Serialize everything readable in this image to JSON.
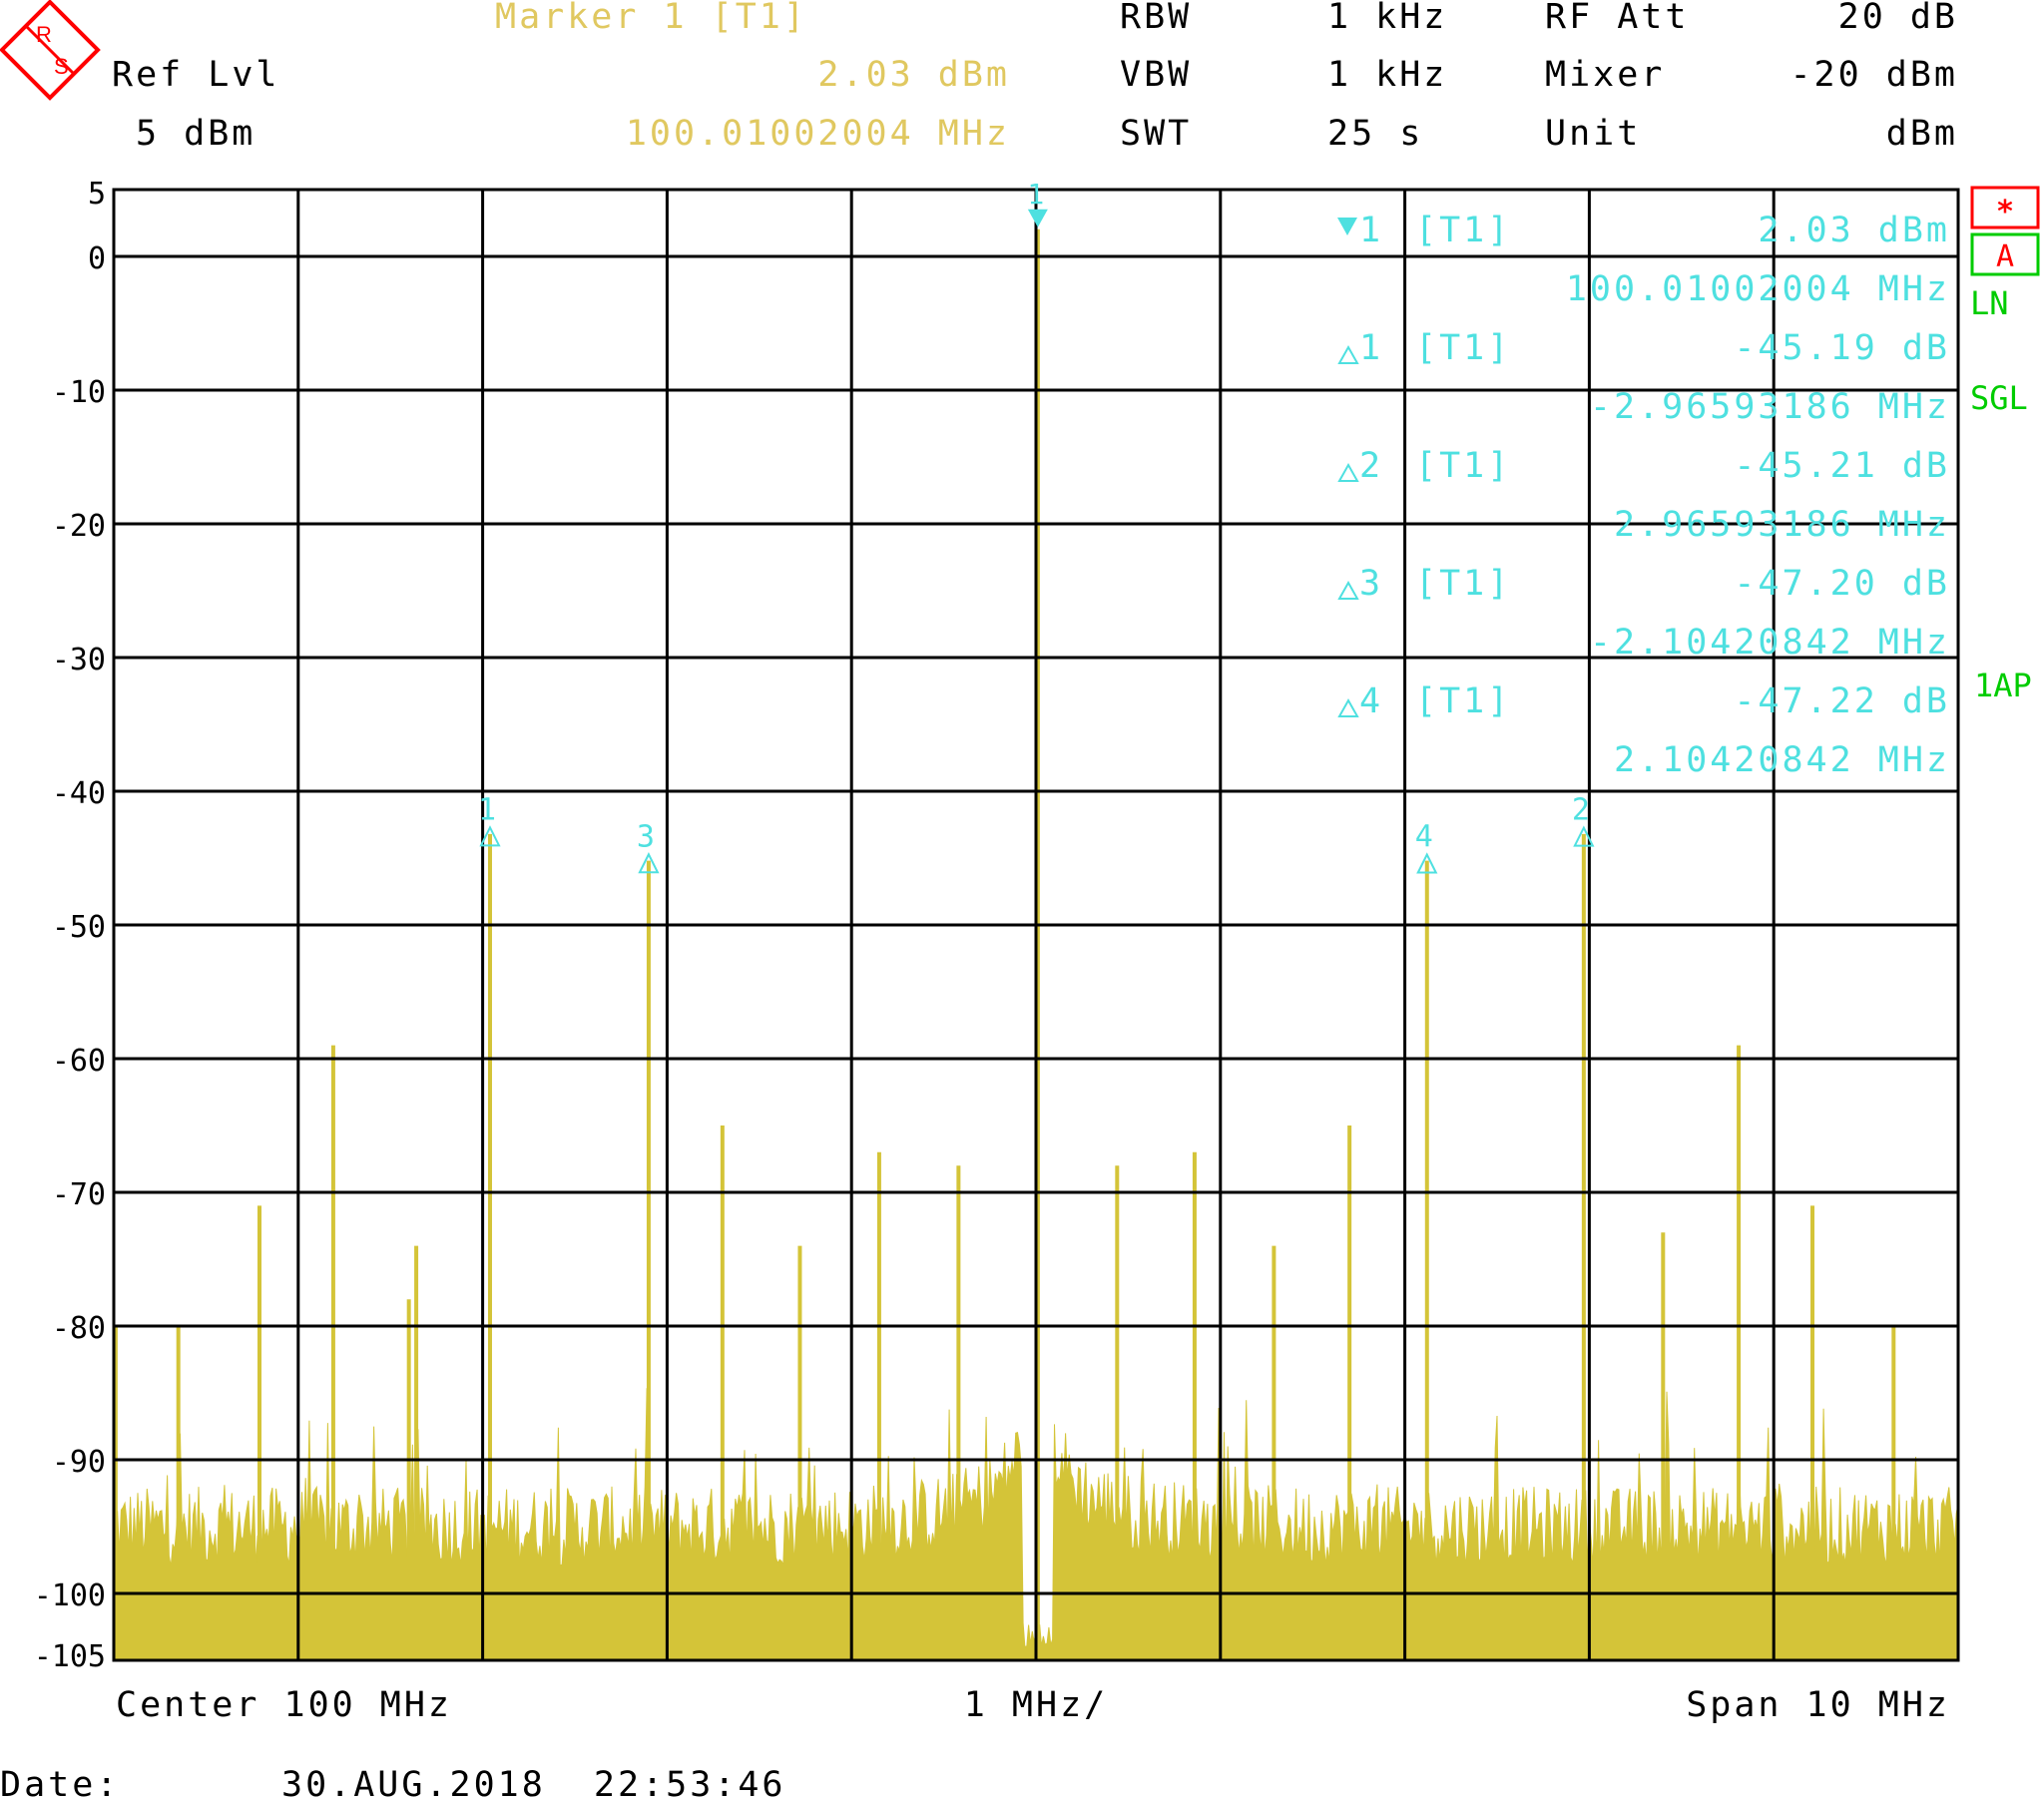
{
  "colors": {
    "background": "#ffffff",
    "grid": "#000000",
    "trace": "#d4c438",
    "header_text": "#000000",
    "marker_header": "#e0c860",
    "marker_cyan": "#4ee0e0",
    "red": "#ff0000",
    "green": "#00cc00"
  },
  "logo": {
    "text_top": "R",
    "text_bottom": "S"
  },
  "header": {
    "marker_title": "Marker 1 [T1]",
    "marker_level": "2.03 dBm",
    "marker_freq": "100.01002004 MHz",
    "ref_label": "Ref Lvl",
    "ref_value": "5 dBm",
    "rbw_label": "RBW",
    "rbw_value": "1 kHz",
    "vbw_label": "VBW",
    "vbw_value": "1 kHz",
    "swt_label": "SWT",
    "swt_value": "25 s",
    "rfatt_label": "RF Att",
    "rfatt_value": "20 dB",
    "mixer_label": "Mixer",
    "mixer_value": "-20 dBm",
    "unit_label": "Unit",
    "unit_value": "dBm"
  },
  "side_labels": {
    "star": "*",
    "a": "A",
    "ln": "LN",
    "sgl": "SGL",
    "ap": "1AP"
  },
  "marker_table": [
    {
      "symbol": "▼",
      "num": "1",
      "trace": "[T1]",
      "value": "2.03 dBm",
      "freq": "100.01002004 MHz"
    },
    {
      "symbol": "△",
      "num": "1",
      "trace": "[T1]",
      "value": "-45.19 dB",
      "freq": "-2.96593186 MHz"
    },
    {
      "symbol": "△",
      "num": "2",
      "trace": "[T1]",
      "value": "-45.21 dB",
      "freq": "2.96593186 MHz"
    },
    {
      "symbol": "△",
      "num": "3",
      "trace": "[T1]",
      "value": "-47.20 dB",
      "freq": "-2.10420842 MHz"
    },
    {
      "symbol": "△",
      "num": "4",
      "trace": "[T1]",
      "value": "-47.22 dB",
      "freq": "2.10420842 MHz"
    }
  ],
  "footer": {
    "center": "Center 100 MHz",
    "div": "1 MHz/",
    "span": "Span 10 MHz",
    "date_label": "Date:",
    "date_value": "30.AUG.2018  22:53:46"
  },
  "chart_data": {
    "type": "line",
    "x_range_mhz": [
      95,
      105
    ],
    "ylim": [
      -105,
      5
    ],
    "y_ticks": [
      5,
      0,
      -10,
      -20,
      -30,
      -40,
      -50,
      -60,
      -70,
      -80,
      -90,
      -100,
      -105
    ],
    "grid": true,
    "noise_floor_dbm": -97,
    "noise_floor_near_carrier_dbm": -104,
    "markers": [
      {
        "label": "1",
        "type": "normal",
        "freq_mhz": 100.01,
        "level_dbm": 2.03
      },
      {
        "label": "1",
        "type": "delta",
        "freq_mhz": 97.04,
        "level_dbm": -43.16
      },
      {
        "label": "2",
        "type": "delta",
        "freq_mhz": 102.97,
        "level_dbm": -43.18
      },
      {
        "label": "3",
        "type": "delta",
        "freq_mhz": 97.9,
        "level_dbm": -45.17
      },
      {
        "label": "4",
        "type": "delta",
        "freq_mhz": 102.12,
        "level_dbm": -45.19
      }
    ],
    "spurs": [
      {
        "freq_mhz": 95.01,
        "level_dbm": -80
      },
      {
        "freq_mhz": 95.35,
        "level_dbm": -80
      },
      {
        "freq_mhz": 95.79,
        "level_dbm": -71
      },
      {
        "freq_mhz": 96.19,
        "level_dbm": -59
      },
      {
        "freq_mhz": 96.64,
        "level_dbm": -74
      },
      {
        "freq_mhz": 96.6,
        "level_dbm": -78
      },
      {
        "freq_mhz": 97.04,
        "level_dbm": -43.2
      },
      {
        "freq_mhz": 97.9,
        "level_dbm": -45.2
      },
      {
        "freq_mhz": 98.3,
        "level_dbm": -65
      },
      {
        "freq_mhz": 98.72,
        "level_dbm": -74
      },
      {
        "freq_mhz": 99.15,
        "level_dbm": -67
      },
      {
        "freq_mhz": 99.58,
        "level_dbm": -68
      },
      {
        "freq_mhz": 100.01,
        "level_dbm": 2.03
      },
      {
        "freq_mhz": 100.44,
        "level_dbm": -68
      },
      {
        "freq_mhz": 100.86,
        "level_dbm": -67
      },
      {
        "freq_mhz": 101.29,
        "level_dbm": -74
      },
      {
        "freq_mhz": 101.7,
        "level_dbm": -65
      },
      {
        "freq_mhz": 102.12,
        "level_dbm": -45.2
      },
      {
        "freq_mhz": 102.97,
        "level_dbm": -43.2
      },
      {
        "freq_mhz": 103.4,
        "level_dbm": -73
      },
      {
        "freq_mhz": 103.81,
        "level_dbm": -59
      },
      {
        "freq_mhz": 104.21,
        "level_dbm": -71
      },
      {
        "freq_mhz": 104.65,
        "level_dbm": -80
      }
    ]
  }
}
